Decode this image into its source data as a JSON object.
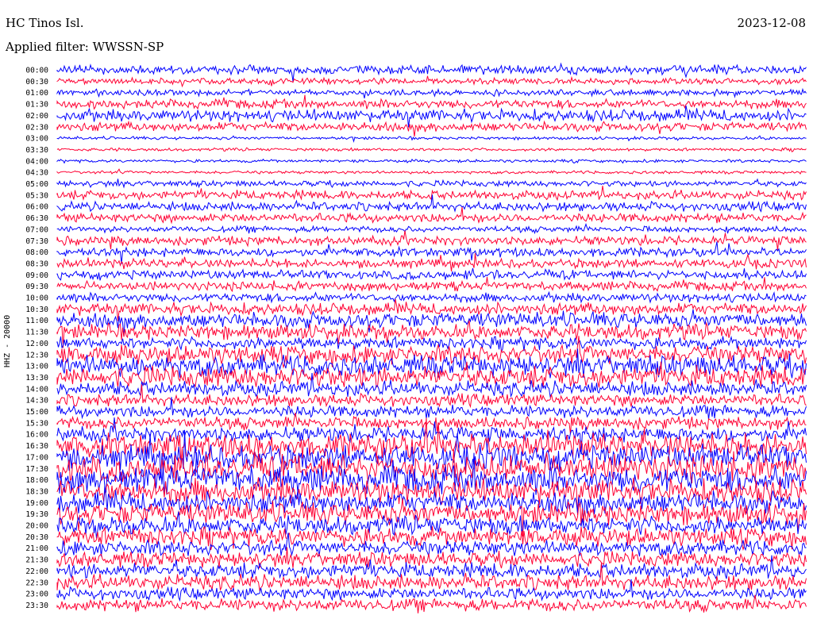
{
  "header": {
    "station": "HC Tinos Isl.",
    "date": "2023-12-08",
    "filter": "Applied filter: WWSSN-SP",
    "channel": "HHZ - 20000"
  },
  "colors": {
    "trace_a": "#0000ff",
    "trace_b": "#ff0033",
    "background": "#ffffff"
  },
  "chart_data": {
    "type": "line",
    "title": "HC Tinos Isl.",
    "subtitle": "Applied filter: WWSSN-SP",
    "ylabel": "HHZ - 20000",
    "row_labels": [
      "00:00",
      "00:30",
      "01:00",
      "01:30",
      "02:00",
      "02:30",
      "03:00",
      "03:30",
      "04:00",
      "04:30",
      "05:00",
      "05:30",
      "06:00",
      "06:30",
      "07:00",
      "07:30",
      "08:00",
      "08:30",
      "09:00",
      "09:30",
      "10:00",
      "10:30",
      "11:00",
      "11:30",
      "12:00",
      "12:30",
      "13:00",
      "13:30",
      "14:00",
      "14:30",
      "15:00",
      "15:30",
      "16:00",
      "16:30",
      "17:00",
      "17:30",
      "18:00",
      "18:30",
      "19:00",
      "19:30",
      "20:00",
      "20:30",
      "21:00",
      "21:30",
      "22:00",
      "22:30",
      "23:00",
      "23:30"
    ],
    "relative_amplitude": [
      3,
      2,
      2,
      3,
      4,
      3,
      1,
      1,
      1,
      1,
      2,
      3,
      3,
      3,
      2,
      3,
      3,
      3,
      3,
      3,
      3,
      4,
      5,
      5,
      4,
      6,
      7,
      7,
      5,
      4,
      4,
      4,
      5,
      8,
      8,
      9,
      9,
      8,
      7,
      7,
      6,
      6,
      5,
      5,
      5,
      5,
      4,
      4
    ],
    "series_colors_alternating": [
      "#0000ff",
      "#ff0033"
    ]
  }
}
